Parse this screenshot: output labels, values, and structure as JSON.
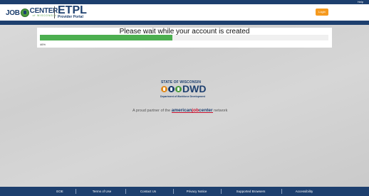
{
  "top_bar": {
    "help_label": "Help"
  },
  "header": {
    "logo": {
      "job": "JOB",
      "center": "CENTER",
      "wisconsin": "of WISCONSIN"
    },
    "app_title": "ETPL",
    "app_subtitle": "Provider Portal",
    "login_label": "Login"
  },
  "status_panel": {
    "message": "Please wait while your account is created",
    "progress_percent": 46,
    "progress_label": "46%"
  },
  "dwd_logo": {
    "state": "STATE OF WISCONSIN",
    "acronym": "DWD",
    "department": "Department of Workforce Development"
  },
  "partner": {
    "prefix": "A proud partner of the",
    "brand_blue": "american",
    "brand_red": "job",
    "brand_blue2": "center",
    "suffix": "network"
  },
  "footer": {
    "links": [
      "EOE",
      "Terms of Use",
      "Contact Us",
      "Privacy Notice",
      "Supported Browsers",
      "Accessibility"
    ]
  },
  "colors": {
    "navy": "#1d3f6e",
    "progress_green": "#4caf50",
    "login_orange": "#f59a1f",
    "brand_red": "#c8102e"
  }
}
